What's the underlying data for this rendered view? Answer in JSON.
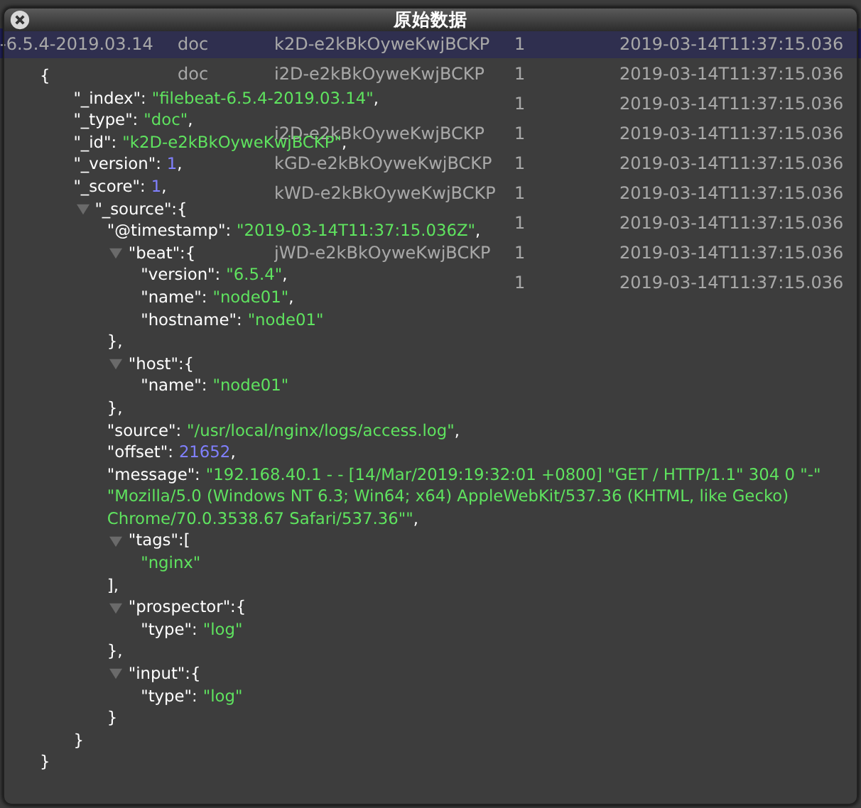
{
  "table": {
    "rows": [
      {
        "index": "-6.5.4-2019.03.14",
        "type": "doc",
        "id": "k2D-e2kBkOyweKwjBCKP",
        "score": "1",
        "timestamp": "2019-03-14T11:37:15.036",
        "selected": true
      },
      {
        "type": "doc",
        "id": "i2D-e2kBkOyweKwjBCKP",
        "score": "1",
        "timestamp": "2019-03-14T11:37:15.036",
        "selected": false
      },
      {
        "score": "1",
        "timestamp": "2019-03-14T11:37:15.036",
        "selected": false
      },
      {
        "id": "i2D-e2kBkOyweKwjBCKP",
        "score": "1",
        "timestamp": "2019-03-14T11:37:15.036",
        "selected": false
      },
      {
        "id": "kGD-e2kBkOyweKwjBCKP",
        "score": "1",
        "timestamp": "2019-03-14T11:37:15.036",
        "selected": false
      },
      {
        "id": "kWD-e2kBkOyweKwjBCKP",
        "score": "1",
        "timestamp": "2019-03-14T11:37:15.036",
        "selected": false
      },
      {
        "score": "1",
        "timestamp": "2019-03-14T11:37:15.036",
        "selected": false
      },
      {
        "id": "jWD-e2kBkOyweKwjBCKP",
        "score": "1",
        "timestamp": "2019-03-14T11:37:15.036",
        "selected": false
      },
      {
        "score": "1",
        "timestamp": "2019-03-14T11:37:15.036",
        "selected": false
      }
    ]
  },
  "dialog": {
    "title": "原始数据",
    "json": {
      "kind": "object",
      "open": "{",
      "close": "}",
      "children": [
        {
          "kind": "string",
          "key": "\"_index\":",
          "value": "\"filebeat-6.5.4-2019.03.14\"",
          "tail": ","
        },
        {
          "kind": "string",
          "key": "\"_type\":",
          "value": "\"doc\"",
          "tail": ","
        },
        {
          "kind": "string",
          "key": "\"_id\":",
          "value": "\"k2D-e2kBkOyweKwjBCKP\"",
          "tail": ","
        },
        {
          "kind": "number",
          "key": "\"_version\":",
          "value": "1",
          "tail": ","
        },
        {
          "kind": "number",
          "key": "\"_score\":",
          "value": "1",
          "tail": ","
        },
        {
          "kind": "object",
          "key": "\"_source\":",
          "open": "{",
          "close": "}",
          "expanded": true,
          "children": [
            {
              "kind": "string",
              "key": "\"@timestamp\":",
              "value": "\"2019-03-14T11:37:15.036Z\"",
              "tail": ","
            },
            {
              "kind": "object",
              "key": "\"beat\":",
              "open": "{",
              "close": "},",
              "expanded": true,
              "children": [
                {
                  "kind": "string",
                  "key": "\"version\":",
                  "value": "\"6.5.4\"",
                  "tail": ","
                },
                {
                  "kind": "string",
                  "key": "\"name\":",
                  "value": "\"node01\"",
                  "tail": ","
                },
                {
                  "kind": "string",
                  "key": "\"hostname\":",
                  "value": "\"node01\""
                }
              ]
            },
            {
              "kind": "object",
              "key": "\"host\":",
              "open": "{",
              "close": "},",
              "expanded": true,
              "children": [
                {
                  "kind": "string",
                  "key": "\"name\":",
                  "value": "\"node01\""
                }
              ]
            },
            {
              "kind": "string",
              "key": "\"source\":",
              "value": "\"/usr/local/nginx/logs/access.log\"",
              "tail": ","
            },
            {
              "kind": "number",
              "key": "\"offset\":",
              "value": "21652",
              "tail": ","
            },
            {
              "kind": "string",
              "key": "\"message\":",
              "value": "\"192.168.40.1 - - [14/Mar/2019:19:32:01 +0800] \"GET / HTTP/1.1\" 304 0 \"-\" \"Mozilla/5.0 (Windows NT 6.3; Win64; x64) AppleWebKit/537.36 (KHTML, like Gecko) Chrome/70.0.3538.67 Safari/537.36\"\"",
              "tail": ","
            },
            {
              "kind": "array",
              "key": "\"tags\":",
              "open": "[",
              "close": "],",
              "expanded": true,
              "children": [
                {
                  "kind": "string",
                  "value": "\"nginx\""
                }
              ]
            },
            {
              "kind": "object",
              "key": "\"prospector\":",
              "open": "{",
              "close": "},",
              "expanded": true,
              "children": [
                {
                  "kind": "string",
                  "key": "\"type\":",
                  "value": "\"log\""
                }
              ]
            },
            {
              "kind": "object",
              "key": "\"input\":",
              "open": "{",
              "close": "}",
              "expanded": true,
              "children": [
                {
                  "kind": "string",
                  "key": "\"type\":",
                  "value": "\"log\""
                }
              ]
            }
          ]
        }
      ]
    }
  }
}
